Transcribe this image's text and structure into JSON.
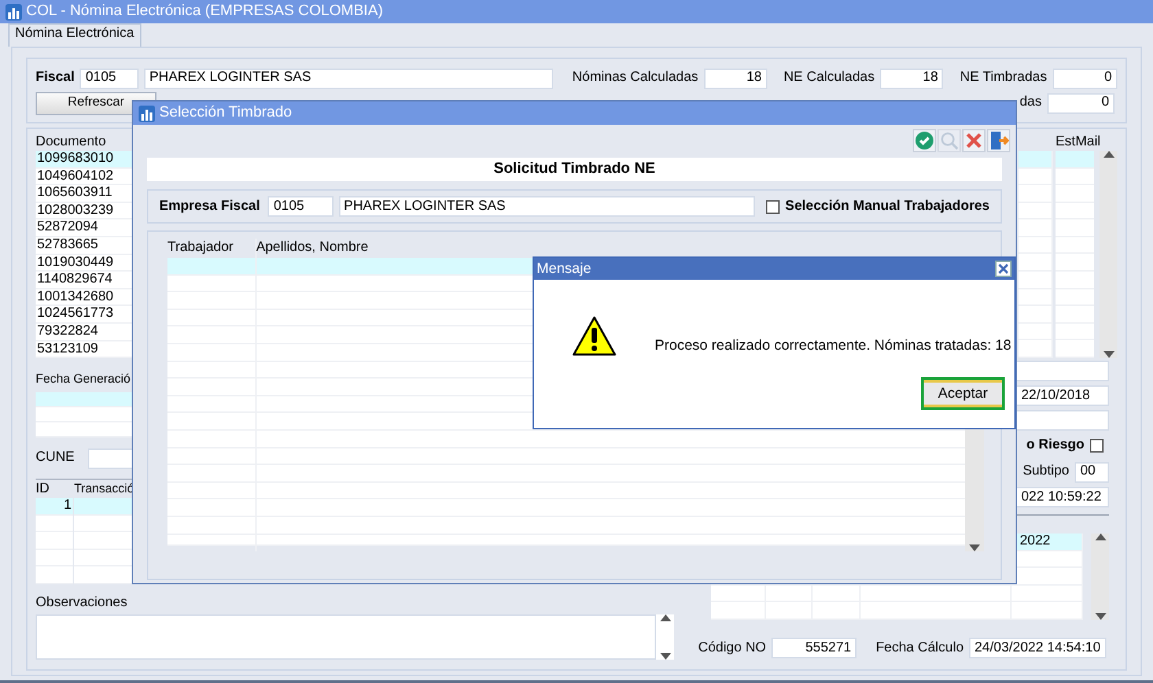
{
  "window": {
    "title": "COL - Nómina Electrónica (EMPRESAS COLOMBIA)"
  },
  "tabs": [
    {
      "label": "Nómina Electrónica",
      "selected": true
    }
  ],
  "header": {
    "fiscal_label": "Fiscal",
    "fiscal_code": "0105",
    "fiscal_name": "PHAREX LOGINTER SAS",
    "refresh_button": "Refrescar",
    "counters": [
      {
        "label": "Nóminas Calculadas",
        "value": "18"
      },
      {
        "label": "NE Calculadas",
        "value": "18"
      },
      {
        "label": "NE Timbradas",
        "value": "0"
      }
    ],
    "second_row_counter": {
      "label": "das",
      "value": "0"
    }
  },
  "documents": {
    "columns": [
      "Documento",
      "EstMail"
    ],
    "rows": [
      {
        "documento": "1099683010",
        "selected": true
      },
      {
        "documento": "1049604102",
        "selected": false
      },
      {
        "documento": "1065603911",
        "selected": false
      },
      {
        "documento": "1028003239",
        "selected": false
      },
      {
        "documento": "52872094",
        "selected": false
      },
      {
        "documento": "52783665",
        "selected": false
      },
      {
        "documento": "1019030449",
        "selected": false
      },
      {
        "documento": "1140829674",
        "selected": false
      },
      {
        "documento": "1001342680",
        "selected": false
      },
      {
        "documento": "1024561773",
        "selected": false
      },
      {
        "documento": "79322824",
        "selected": false
      },
      {
        "documento": "53123109",
        "selected": false
      }
    ]
  },
  "lower_left": {
    "fecha_generacion_label": "Fecha Generació",
    "cune_label": "CUNE",
    "transactions": {
      "columns": [
        "ID",
        "Transacció"
      ],
      "rows": [
        {
          "id": "1",
          "selected": true
        }
      ]
    },
    "observaciones_label": "Observaciones"
  },
  "lower_right": {
    "fecha": "22/10/2018",
    "riesgo_label": "o Riesgo",
    "riesgo_checked": false,
    "subtipo_label": "Subtipo",
    "subtipo": "00",
    "timestamp": "022 10:59:22",
    "grid_rows": [
      {
        "cell": "2022",
        "selected": true
      }
    ],
    "codigo_label": "Código NO",
    "codigo": "555271",
    "fecha_calculo_label": "Fecha Cálculo",
    "fecha_calculo": "24/03/2022 14:54:10"
  },
  "dialog": {
    "title": "Selección Timbrado",
    "toolbar": [
      {
        "kind": "accept",
        "disabled": false
      },
      {
        "kind": "search",
        "disabled": true
      },
      {
        "kind": "cancel",
        "disabled": false
      },
      {
        "kind": "exit",
        "disabled": false
      }
    ],
    "heading": "Solicitud Timbrado NE",
    "empresa_label": "Empresa Fiscal",
    "empresa_code": "0105",
    "empresa_name": "PHAREX LOGINTER SAS",
    "manual_label": "Selección Manual Trabajadores",
    "manual_checked": false,
    "grid": {
      "columns": [
        "Trabajador",
        "Apellidos, Nombre"
      ]
    }
  },
  "message": {
    "title": "Mensaje",
    "text": "Proceso realizado correctamente. Nóminas tratadas: 18",
    "button": "Aceptar"
  }
}
